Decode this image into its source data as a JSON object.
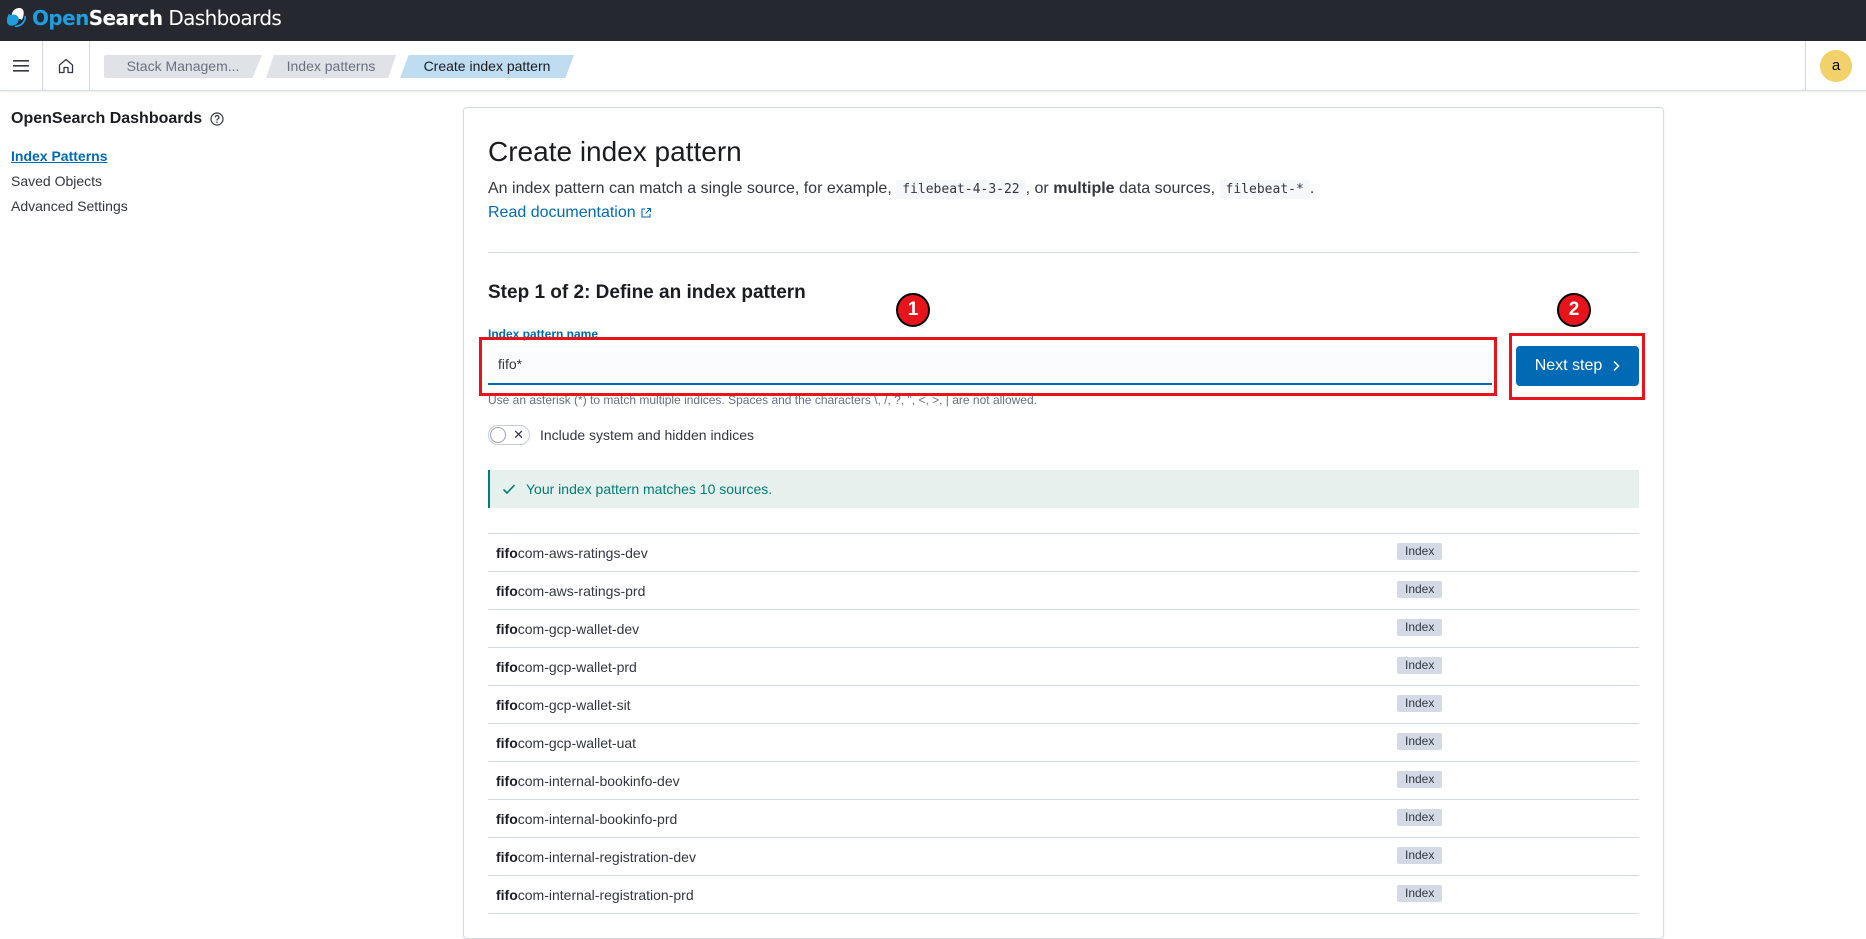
{
  "topbar": {
    "brand_part1": "Open",
    "brand_part2": "Search",
    "brand_part3": " Dashboards"
  },
  "header": {
    "breadcrumbs": [
      "Stack Managem...",
      "Index patterns",
      "Create index pattern"
    ],
    "avatar_initial": "a"
  },
  "sidebar": {
    "title": "OpenSearch Dashboards",
    "items": [
      {
        "label": "Index Patterns",
        "active": true
      },
      {
        "label": "Saved Objects",
        "active": false
      },
      {
        "label": "Advanced Settings",
        "active": false
      }
    ]
  },
  "main": {
    "title": "Create index pattern",
    "description_1": "An index pattern can match a single source, for example,",
    "code_1": "filebeat-4-3-22",
    "description_2": ", or",
    "description_bold": "multiple",
    "description_3": "data sources,",
    "code_2": "filebeat-*",
    "description_4": ".",
    "doc_link": "Read documentation",
    "step_title": "Step 1 of 2: Define an index pattern",
    "field_label": "Index pattern name",
    "field_value": "fifo*",
    "help_text": "Use an asterisk (*) to match multiple indices. Spaces and the characters \\, /, ?, \", <, >, | are not allowed.",
    "toggle_label": "Include system and hidden indices",
    "match_text": "Your index pattern matches 10 sources.",
    "next_button": "Next step",
    "rows": [
      {
        "prefix": "fifo",
        "suffix": "com-aws-ratings-dev",
        "type": "Index"
      },
      {
        "prefix": "fifo",
        "suffix": "com-aws-ratings-prd",
        "type": "Index"
      },
      {
        "prefix": "fifo",
        "suffix": "com-gcp-wallet-dev",
        "type": "Index"
      },
      {
        "prefix": "fifo",
        "suffix": "com-gcp-wallet-prd",
        "type": "Index"
      },
      {
        "prefix": "fifo",
        "suffix": "com-gcp-wallet-sit",
        "type": "Index"
      },
      {
        "prefix": "fifo",
        "suffix": "com-gcp-wallet-uat",
        "type": "Index"
      },
      {
        "prefix": "fifo",
        "suffix": "com-internal-bookinfo-dev",
        "type": "Index"
      },
      {
        "prefix": "fifo",
        "suffix": "com-internal-bookinfo-prd",
        "type": "Index"
      },
      {
        "prefix": "fifo",
        "suffix": "com-internal-registration-dev",
        "type": "Index"
      },
      {
        "prefix": "fifo",
        "suffix": "com-internal-registration-prd",
        "type": "Index"
      }
    ]
  },
  "annotations": {
    "marker_1": "1",
    "marker_2": "2"
  },
  "colors": {
    "accent": "#006bb4",
    "annotation": "#e8141b",
    "success": "#017d73",
    "topbar": "#25282f"
  }
}
